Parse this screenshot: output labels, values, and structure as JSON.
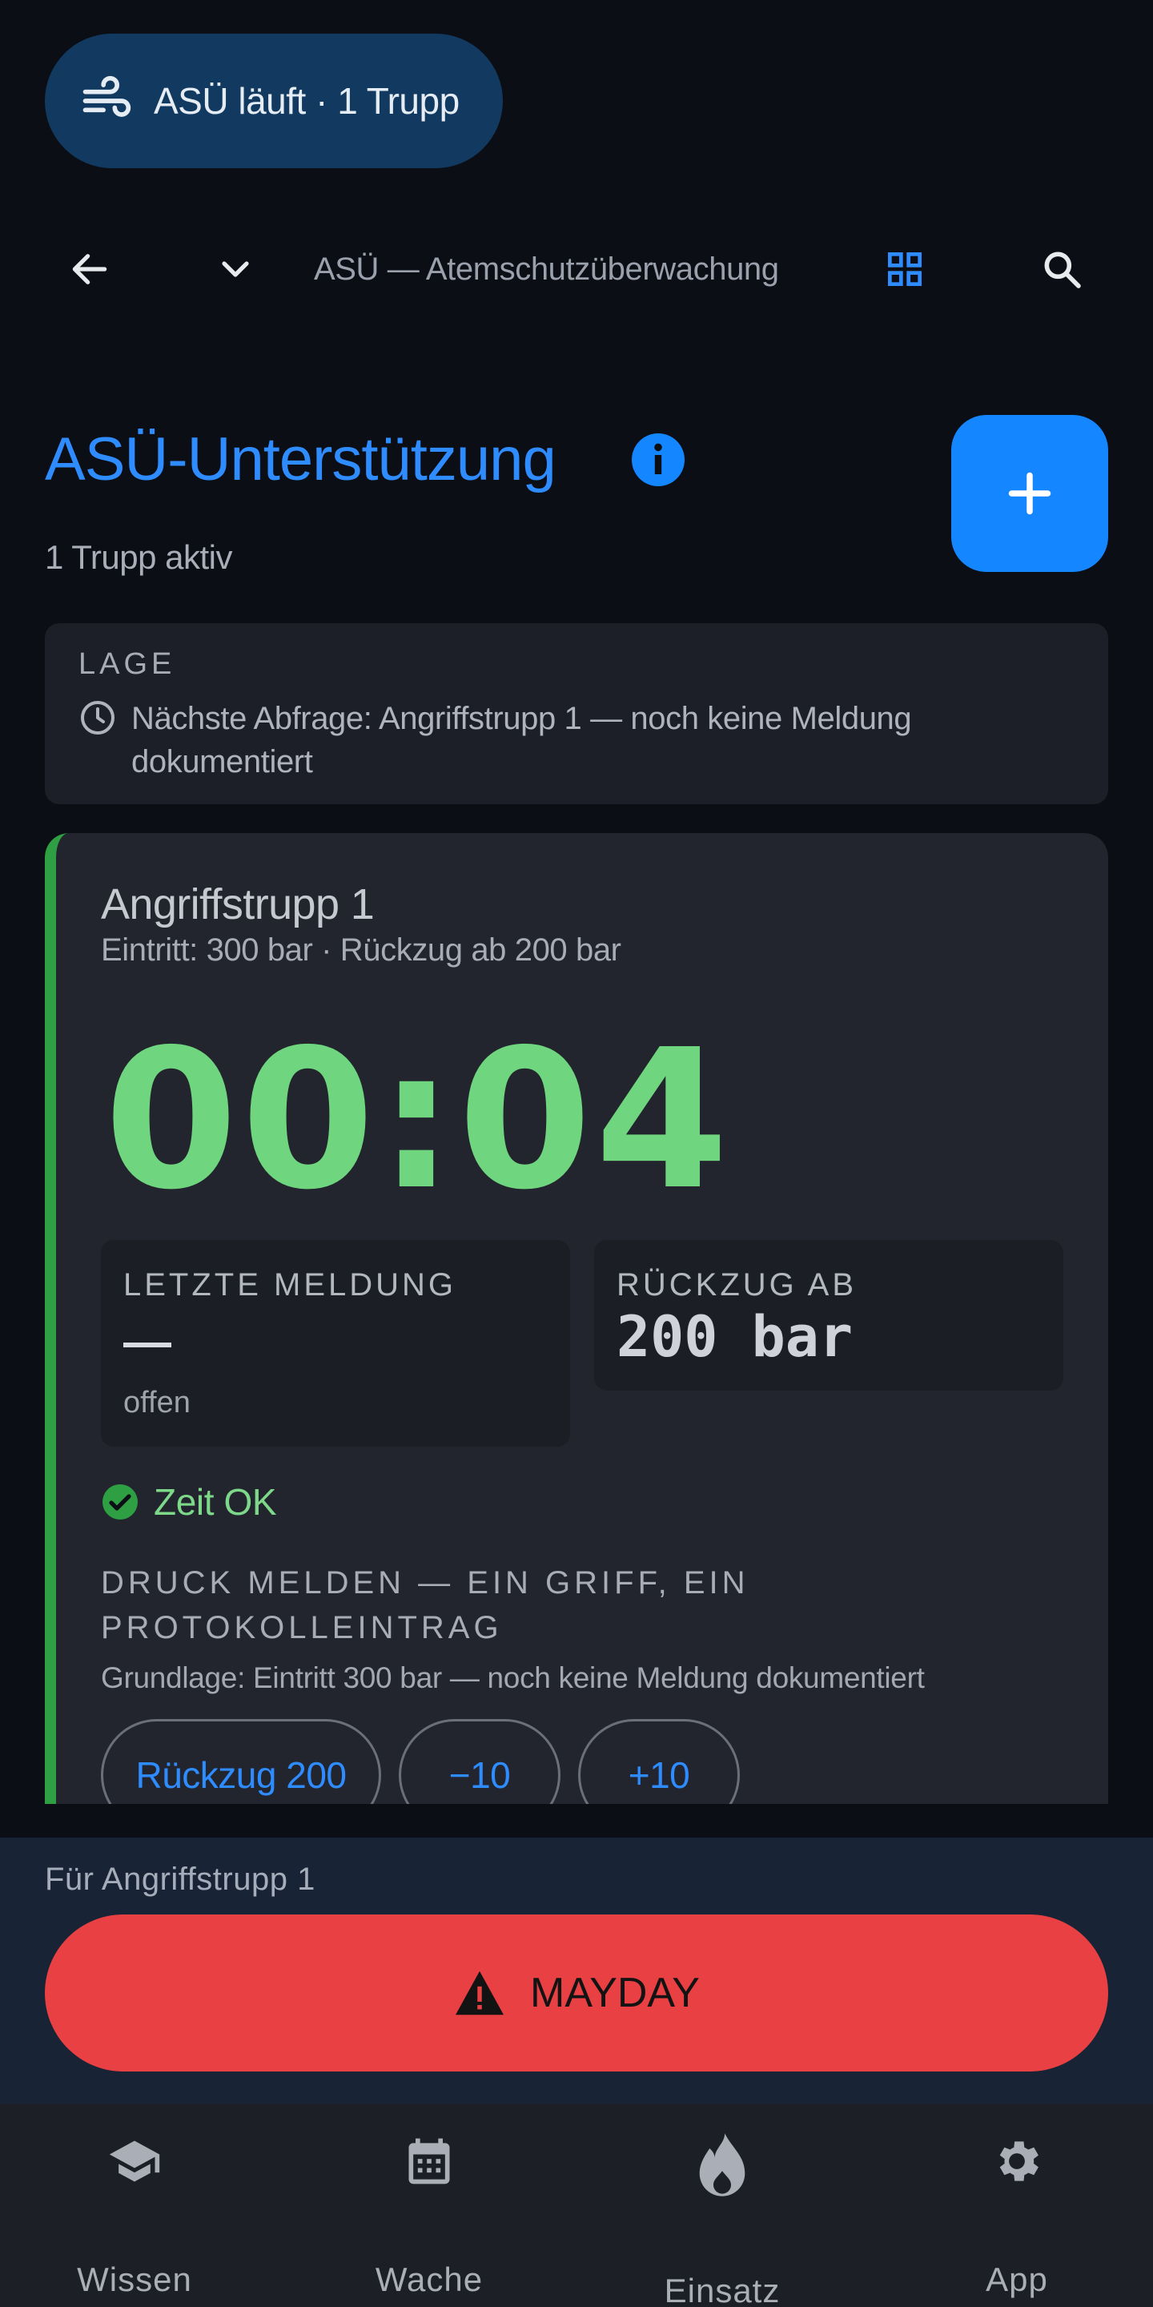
{
  "status": {
    "text": "ASÜ läuft · 1 Trupp",
    "icon": "wind-icon"
  },
  "appbar": {
    "title": "ASÜ — Atemschutzüberwachung"
  },
  "header": {
    "title": "ASÜ-Unterstützung",
    "subtitle": "1 Trupp aktiv"
  },
  "lage": {
    "label": "LAGE",
    "text": "Nächste Abfrage: Angriffstrupp 1 — noch keine Meldung dokumentiert"
  },
  "trupp": {
    "name": "Angriffstrupp 1",
    "meta": "Eintritt: 300 bar · Rückzug ab 200 bar",
    "timer": "00:04",
    "last_report_label": "LETZTE MELDUNG",
    "last_report_value": "—",
    "last_report_status": "offen",
    "retreat_label": "RÜCKZUG AB",
    "retreat_value": "200 bar",
    "time_status": "Zeit OK",
    "report_label": "DRUCK MELDEN — EIN GRIFF, EIN PROTOKOLLEINTRAG",
    "basis": "Grundlage: Eintritt 300 bar — noch keine Meldung dokumentiert",
    "chips": [
      "Rückzug 200",
      "−10",
      "+10"
    ]
  },
  "mayday": {
    "for": "Für Angriffstrupp 1",
    "label": "MAYDAY"
  },
  "nav": [
    {
      "label": "Wissen",
      "icon": "graduation-cap-icon"
    },
    {
      "label": "Wache",
      "icon": "calendar-icon"
    },
    {
      "label": "Einsatz",
      "icon": "flame-icon"
    },
    {
      "label": "App",
      "icon": "gear-icon"
    }
  ],
  "colors": {
    "accent": "#1486ff",
    "ok": "#6fd67f",
    "mayday": "#e84043",
    "card": "#22252d"
  }
}
